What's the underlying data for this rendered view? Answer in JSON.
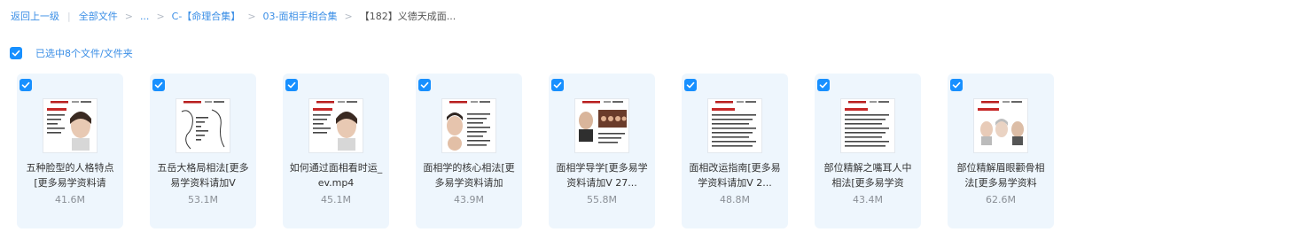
{
  "breadcrumb": {
    "back": "返回上一级",
    "all_files": "全部文件",
    "ellipsis": "...",
    "level1": "C-【命理合集】",
    "level2": "03-面相手相合集",
    "current": "【182】义德天成面..."
  },
  "selection": {
    "text": "已选中8个文件/文件夹"
  },
  "files": [
    {
      "name": "五种脸型的人格特点[更多易学资料请",
      "size": "41.6M",
      "thumb": "face-portrait"
    },
    {
      "name": "五岳大格局相法[更多易学资料请加V",
      "size": "53.1M",
      "thumb": "sketch"
    },
    {
      "name": "如何通过面相看时运_ev.mp4",
      "size": "45.1M",
      "thumb": "face-portrait"
    },
    {
      "name": "面相学的核心相法[更多易学资料请加",
      "size": "43.9M",
      "thumb": "faces-side"
    },
    {
      "name": "面相学导学[更多易学资料请加V 27...",
      "size": "55.8M",
      "thumb": "faces-row"
    },
    {
      "name": "面相改运指南[更多易学资料请加V 2...",
      "size": "48.8M",
      "thumb": "text-slide"
    },
    {
      "name": "部位精解之嘴耳人中相法[更多易学资",
      "size": "43.4M",
      "thumb": "text-slide"
    },
    {
      "name": "部位精解眉眼颧骨相法[更多易学资料",
      "size": "62.6M",
      "thumb": "faces-three"
    }
  ],
  "colors": {
    "accent": "#1890ff",
    "link": "#3a8ee6",
    "card_bg": "#eef6fd"
  }
}
